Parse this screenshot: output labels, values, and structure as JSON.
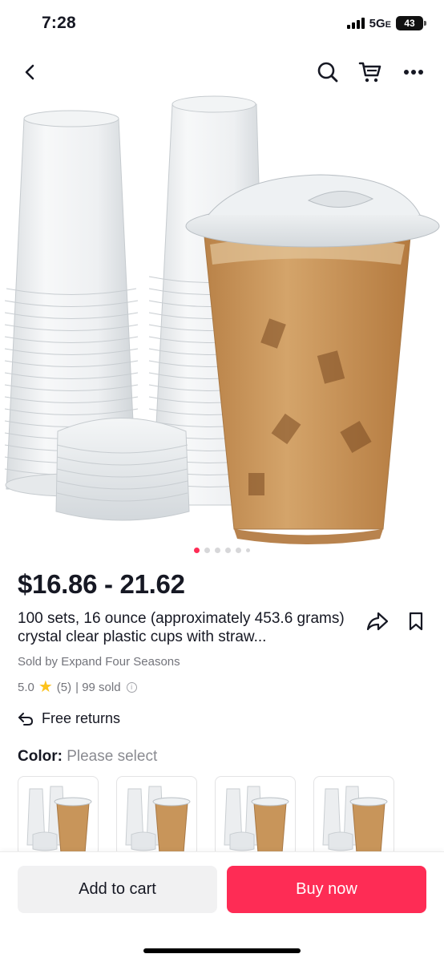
{
  "status": {
    "time": "7:28",
    "network": "5G",
    "network_suffix": "E",
    "battery": "43"
  },
  "nav": {
    "back_icon": "chevron-left-icon",
    "search_icon": "search-icon",
    "cart_icon": "cart-icon",
    "more_icon": "more-icon"
  },
  "gallery": {
    "image_count": 6,
    "active_index": 0
  },
  "product": {
    "price": "$16.86 - 21.62",
    "title": "100 sets, 16 ounce (approximately 453.6 grams) crystal clear plastic cups with straw...",
    "seller": "Sold by Expand Four Seasons",
    "rating": "5.0",
    "review_count": "(5)",
    "sold": "| 99 sold",
    "returns": "Free returns"
  },
  "variant": {
    "label": "Color:",
    "value": "Please select",
    "option_count": 4
  },
  "actions": {
    "add_to_cart": "Add to cart",
    "buy_now": "Buy now"
  },
  "colors": {
    "accent": "#fe2c55",
    "star": "#fcc21b",
    "coffee": "#c8955a"
  }
}
